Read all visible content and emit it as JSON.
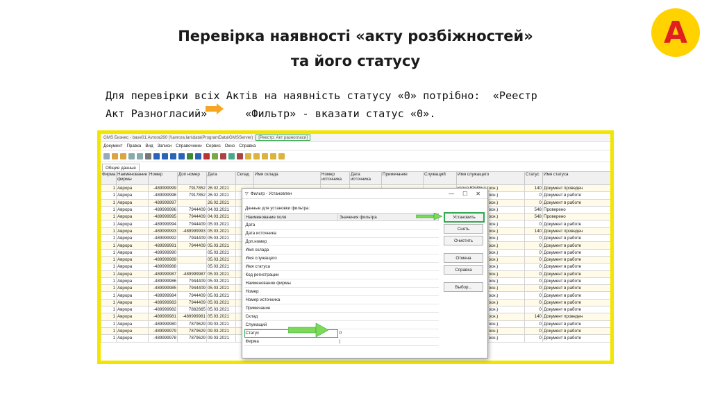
{
  "slide": {
    "title_line1": "Перевірка наявності «акту розбіжностей»",
    "title_line2": "та його статусу",
    "badge": "А",
    "instr_line1": "Для перевірки всіх Актів на наявність статусу «0» потрібно:  «Реестр",
    "instr_line2": "Акт Разногласий»      «Фильтр» - вказати статус «0»."
  },
  "colors": {
    "frame": "#f2e600",
    "badge": "#ffd200",
    "badge_text": "#e02020",
    "highlight": "#2fa84f",
    "orange_arrow": "#f5a623"
  },
  "app": {
    "title": "GMS Бизнес - base01.Аvrora260 (\\\\avrora.lan\\data\\ProgramData\\GMSServer)",
    "title_highlight": "[Реестр: Акт разногласи]",
    "menu": [
      "Документ",
      "Правка",
      "Вид",
      "Записи",
      "Справочники",
      "Сервис",
      "Окно",
      "Справка"
    ],
    "tab": "Общие данные",
    "columns": [
      "Фирма",
      "Наименование фирмы",
      "Номер",
      "Доп номер",
      "Дата",
      "Склад",
      "Имя склада",
      "Номер источника",
      "Дата источника",
      "Примечание",
      "Служащий",
      "Имя служащего",
      "Статус",
      "Имя статуса"
    ],
    "rows": [
      [
        "1",
        "Аврора",
        "-489999999",
        "7917852",
        "26.02.2021",
        "",
        "",
        "",
        "",
        "",
        "",
        "ксана Юріївна (осн.)",
        "140",
        "Документ проведен"
      ],
      [
        "1",
        "Аврора",
        "-489999998",
        "7917852",
        "26.02.2021",
        "",
        "",
        "",
        "",
        "",
        "",
        "ксана Юріївна (осн.)",
        "0",
        "Документ в работе"
      ],
      [
        "1",
        "Аврора",
        "-489999997",
        "",
        "26.02.2021",
        "",
        "",
        "",
        "",
        "",
        "",
        "ксана Юріївна (осн.)",
        "0",
        "Документ в работе"
      ],
      [
        "1",
        "Аврора",
        "-489999996",
        "7944409",
        "04.03.2021",
        "",
        "",
        "",
        "",
        "",
        "",
        "ксана Юріївна (осн.)",
        "548",
        "Проверено"
      ],
      [
        "1",
        "Аврора",
        "-489999995",
        "7944409",
        "04.03.2021",
        "",
        "",
        "",
        "",
        "",
        "",
        "ксана Юріївна (осн.)",
        "548",
        "Проверено"
      ],
      [
        "1",
        "Аврора",
        "-489999994",
        "7944409",
        "05.03.2021",
        "",
        "",
        "",
        "",
        "",
        "",
        "ксана Юріївна (осн.)",
        "0",
        "Документ в работе"
      ],
      [
        "1",
        "Аврора",
        "-489999993",
        "-489999993",
        "05.03.2021",
        "",
        "",
        "",
        "",
        "",
        "",
        "ксана Юріївна (осн.)",
        "140",
        "Документ проведен"
      ],
      [
        "1",
        "Аврора",
        "-489999992",
        "7944409",
        "05.03.2021",
        "",
        "",
        "",
        "",
        "",
        "",
        "ксана Юріївна (осн.)",
        "0",
        "Документ в работе"
      ],
      [
        "1",
        "Аврора",
        "-489999991",
        "7944409",
        "05.03.2021",
        "",
        "",
        "",
        "",
        "",
        "",
        "ксана Юріївна (осн.)",
        "0",
        "Документ в работе"
      ],
      [
        "1",
        "Аврора",
        "-489999990",
        "",
        "05.03.2021",
        "",
        "",
        "",
        "",
        "",
        "",
        "ксана Юріївна (осн.)",
        "0",
        "Документ в работе"
      ],
      [
        "1",
        "Аврора",
        "-489999989",
        "",
        "05.03.2021",
        "",
        "",
        "",
        "",
        "",
        "",
        "ксана Юріївна (осн.)",
        "0",
        "Документ в работе"
      ],
      [
        "1",
        "Аврора",
        "-489999988",
        "",
        "05.03.2021",
        "",
        "",
        "",
        "",
        "",
        "",
        "ксана Юріївна (осн.)",
        "0",
        "Документ в работе"
      ],
      [
        "1",
        "Аврора",
        "-489999987",
        "-489999987",
        "05.03.2021",
        "",
        "",
        "",
        "",
        "",
        "",
        "ксана Юріївна (осн.)",
        "0",
        "Документ в работе"
      ],
      [
        "1",
        "Аврора",
        "-489999986",
        "7944409",
        "05.03.2021",
        "",
        "",
        "",
        "",
        "",
        "",
        "ксана Юріївна (осн.)",
        "0",
        "Документ в работе"
      ],
      [
        "1",
        "Аврора",
        "-489999985",
        "7944409",
        "05.03.2021",
        "",
        "",
        "",
        "",
        "",
        "",
        "ксана Юріївна (осн.)",
        "0",
        "Документ в работе"
      ],
      [
        "1",
        "Аврора",
        "-489999984",
        "7944409",
        "05.03.2021",
        "",
        "",
        "",
        "",
        "",
        "",
        "ксана Юріївна (осн.)",
        "0",
        "Документ в работе"
      ],
      [
        "1",
        "Аврора",
        "-489999983",
        "7944409",
        "05.03.2021",
        "",
        "",
        "",
        "",
        "",
        "",
        "ксана Юріївна (осн.)",
        "0",
        "Документ в работе"
      ],
      [
        "1",
        "Аврора",
        "-489999982",
        "7882665",
        "05.03.2021",
        "",
        "",
        "",
        "",
        "",
        "",
        "ксана Юріївна (осн.)",
        "0",
        "Документ в работе"
      ],
      [
        "1",
        "Аврора",
        "-489999981",
        "-489999981",
        "05.03.2021",
        "",
        "",
        "",
        "",
        "",
        "",
        "ксана Юріївна (осн.)",
        "140",
        "Документ проведен"
      ],
      [
        "1",
        "Аврора",
        "-489999980",
        "7879629",
        "09.03.2021",
        "",
        "",
        "",
        "",
        "",
        "",
        "ксана Юріївна (осн.)",
        "0",
        "Документ в работе"
      ],
      [
        "1",
        "Аврора",
        "-489999979",
        "7879629",
        "09.03.2021",
        "",
        "",
        "",
        "",
        "",
        "",
        "ксана Юріївна (осн.)",
        "0",
        "Документ в работе"
      ],
      [
        "1",
        "Аврора",
        "-489999978",
        "7879629",
        "09.03.2021",
        "",
        "",
        "",
        "",
        "",
        "",
        "ксана Юріївна (осн.)",
        "0",
        "Документ в работе"
      ]
    ]
  },
  "filter": {
    "title": "Фильтр - Установлен",
    "label": "Данные для установки фильтра:",
    "col_field": "Наименование поля",
    "col_value": "Значения фильтра",
    "fields": [
      "Дата",
      "Дата источника",
      "Доп.номер",
      "Имя склада",
      "Имя служащего",
      "Имя статуса",
      "Код регистрации",
      "Наименование фирмы",
      "Номер",
      "Номер источника",
      "Примечание",
      "Склад",
      "Служащий",
      "Статус",
      "Фирма"
    ],
    "status_value": "0",
    "buttons": [
      "Установить",
      "Снять",
      "Очистить",
      "Отмена",
      "Справка",
      "Выбор..."
    ],
    "controls": [
      "—",
      "☐",
      "✕"
    ]
  }
}
